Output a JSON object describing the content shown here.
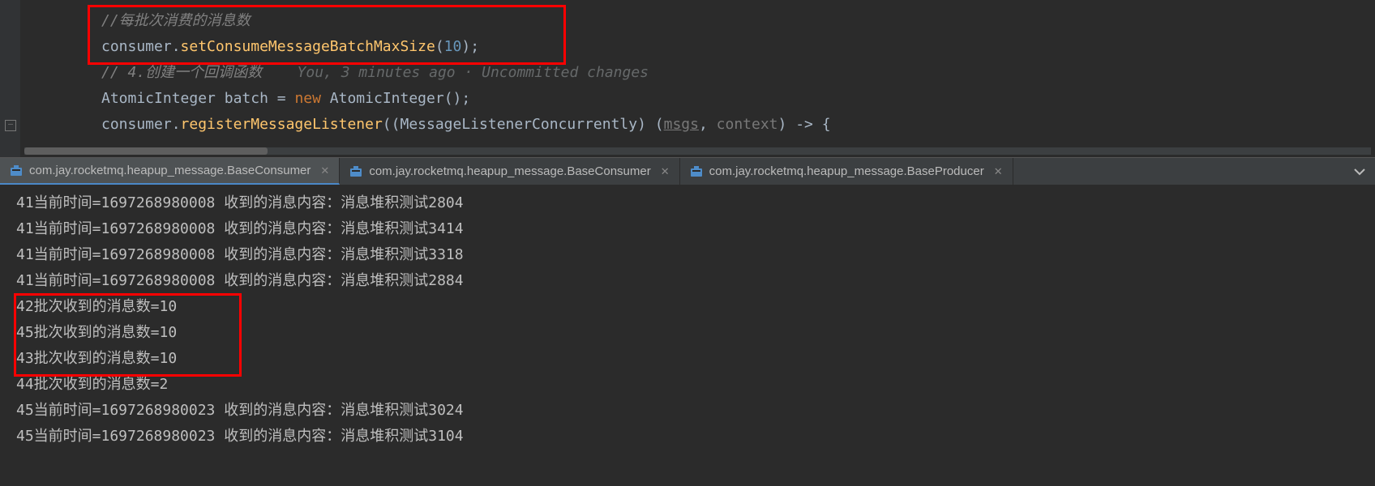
{
  "code": {
    "line1_comment": "//每批次消费的消息数",
    "line2_obj": "consumer",
    "line2_dot": ".",
    "line2_method": "setConsumeMessageBatchMaxSize",
    "line2_lp": "(",
    "line2_arg": "10",
    "line2_rp": ")",
    "line2_sc": ";",
    "line3_comment": "// 4.创建一个回调函数",
    "line3_vcs": "You, 3 minutes ago · Uncommitted changes",
    "line4_type": "AtomicInteger",
    "line4_sp1": " ",
    "line4_var": "batch",
    "line4_eq": " = ",
    "line4_new": "new",
    "line4_sp2": " ",
    "line4_ctor": "AtomicInteger",
    "line4_tail": "();",
    "line5_obj": "consumer",
    "line5_dot": ".",
    "line5_method": "registerMessageListener",
    "line5_lp": "((",
    "line5_cast": "MessageListenerConcurrently",
    "line5_mid": ") (",
    "line5_p1": "msgs",
    "line5_c": ", ",
    "line5_p2": "context",
    "line5_arrow": ") -> {"
  },
  "tabs": [
    {
      "label": "com.jay.rocketmq.heapup_message.BaseConsumer",
      "active": true
    },
    {
      "label": "com.jay.rocketmq.heapup_message.BaseConsumer",
      "active": false
    },
    {
      "label": "com.jay.rocketmq.heapup_message.BaseProducer",
      "active": false
    }
  ],
  "console": {
    "lines": [
      "41当前时间=1697268980008 收到的消息内容：消息堆积测试2804",
      "41当前时间=1697268980008 收到的消息内容：消息堆积测试3414",
      "41当前时间=1697268980008 收到的消息内容：消息堆积测试3318",
      "41当前时间=1697268980008 收到的消息内容：消息堆积测试2884",
      "42批次收到的消息数=10",
      "45批次收到的消息数=10",
      "43批次收到的消息数=10",
      "44批次收到的消息数=2",
      "45当前时间=1697268980023 收到的消息内容：消息堆积测试3024",
      "45当前时间=1697268980023 收到的消息内容：消息堆积测试3104"
    ]
  }
}
